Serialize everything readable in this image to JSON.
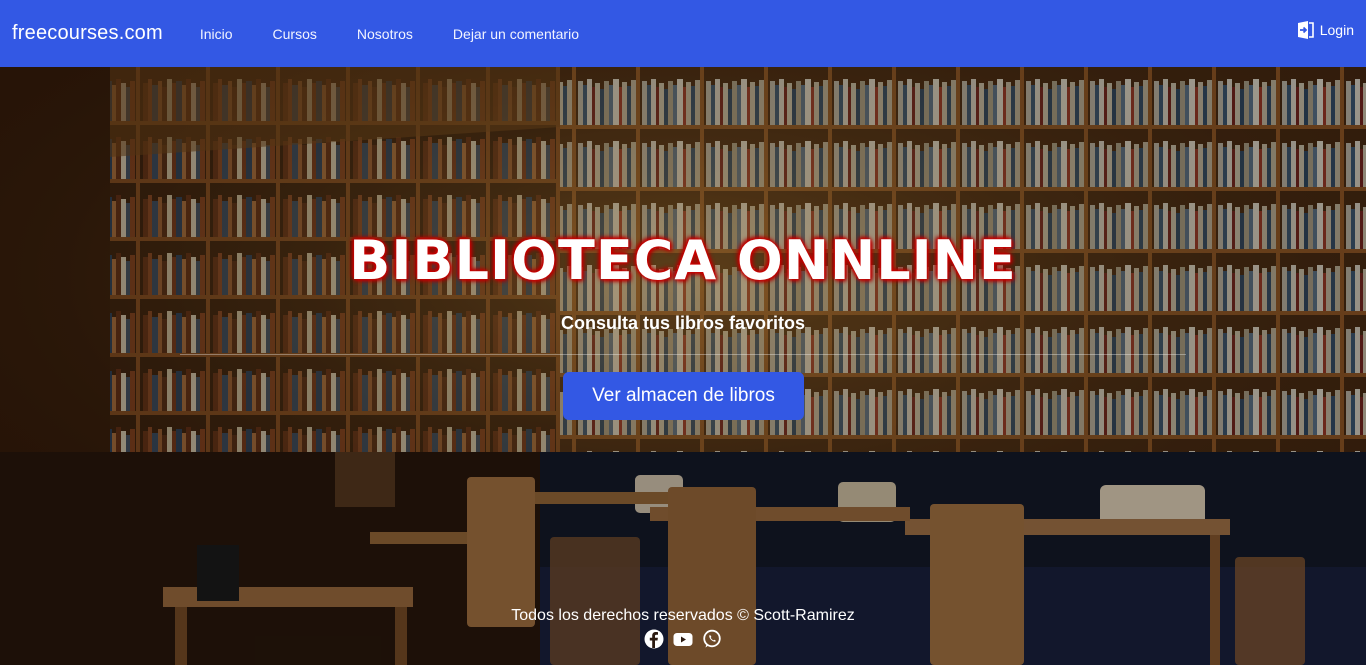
{
  "navbar": {
    "brand": "freecourses.com",
    "links": [
      "Inicio",
      "Cursos",
      "Nosotros",
      "Dejar un comentario"
    ],
    "login_label": "Login"
  },
  "hero": {
    "title": "BIBLIOTECA ONNLINE",
    "subtitle": "Consulta tus libros favoritos",
    "button_label": "Ver almacen de libros"
  },
  "footer": {
    "copyright": "Todos los derechos reservados © Scott-Ramirez",
    "social_icons": [
      "facebook-icon",
      "youtube-icon",
      "whatsapp-icon"
    ]
  },
  "colors": {
    "primary": "#3358e4",
    "title_glow": "#d40000"
  }
}
